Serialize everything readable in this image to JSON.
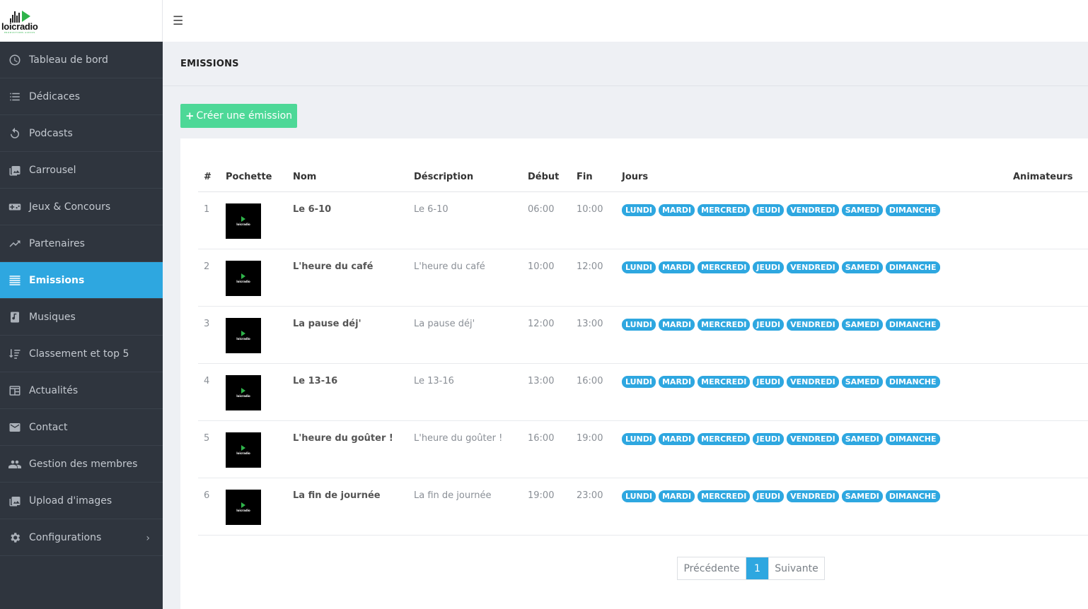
{
  "brand": {
    "logo_text": "loicradio",
    "logo_sub": "PRODUCTIONS AUDIOS"
  },
  "sidebar": {
    "items": [
      {
        "label": "Tableau de bord",
        "icon": "dashboard-icon"
      },
      {
        "label": "Dédicaces",
        "icon": "list-icon"
      },
      {
        "label": "Podcasts",
        "icon": "replay-icon"
      },
      {
        "label": "Carrousel",
        "icon": "image-icon"
      },
      {
        "label": "Jeux & Concours",
        "icon": "gamepad-icon"
      },
      {
        "label": "Partenaires",
        "icon": "trending-icon"
      },
      {
        "label": "Emissions",
        "icon": "lines-icon",
        "active": true
      },
      {
        "label": "Musiques",
        "icon": "music-note-icon"
      },
      {
        "label": "Classement et top 5",
        "icon": "ranking-icon"
      },
      {
        "label": "Actualités",
        "icon": "news-icon"
      },
      {
        "label": "Contact",
        "icon": "mail-icon"
      },
      {
        "label": "Gestion des membres",
        "icon": "people-icon"
      },
      {
        "label": "Upload d'images",
        "icon": "image-upload-icon"
      },
      {
        "label": "Configurations",
        "icon": "gear-icon",
        "chevron": "›"
      }
    ]
  },
  "topbar": {
    "menu_icon": "☰"
  },
  "page": {
    "title": "EMISSIONS"
  },
  "actions": {
    "create_label": "Créer une émission",
    "create_icon": "+"
  },
  "table": {
    "headers": [
      "#",
      "Pochette",
      "Nom",
      "Déscription",
      "Début",
      "Fin",
      "Jours",
      "Animateurs"
    ],
    "thumb_text": "loicradio",
    "days": [
      "LUNDI",
      "MARDI",
      "MERCREDI",
      "JEUDI",
      "VENDREDI",
      "SAMEDI",
      "DIMANCHE"
    ],
    "rows": [
      {
        "num": "1",
        "name": "Le 6-10",
        "desc": "Le 6-10",
        "start": "06:00",
        "end": "10:00"
      },
      {
        "num": "2",
        "name": "L'heure du café",
        "desc": "L'heure du café",
        "start": "10:00",
        "end": "12:00"
      },
      {
        "num": "3",
        "name": "La pause déj'",
        "desc": "La pause déj'",
        "start": "12:00",
        "end": "13:00"
      },
      {
        "num": "4",
        "name": "Le 13-16",
        "desc": "Le 13-16",
        "start": "13:00",
        "end": "16:00"
      },
      {
        "num": "5",
        "name": "L'heure du goûter !",
        "desc": "L'heure du goûter !",
        "start": "16:00",
        "end": "19:00"
      },
      {
        "num": "6",
        "name": "La fin de journée",
        "desc": "La fin de journée",
        "start": "19:00",
        "end": "23:00"
      }
    ]
  },
  "pagination": {
    "prev": "Précédente",
    "current": "1",
    "next": "Suivante"
  },
  "colors": {
    "sidebar_bg": "#2f353e",
    "accent": "#2ea7e0",
    "create_button": "#4dd897",
    "logo_green": "#2fb34a"
  }
}
